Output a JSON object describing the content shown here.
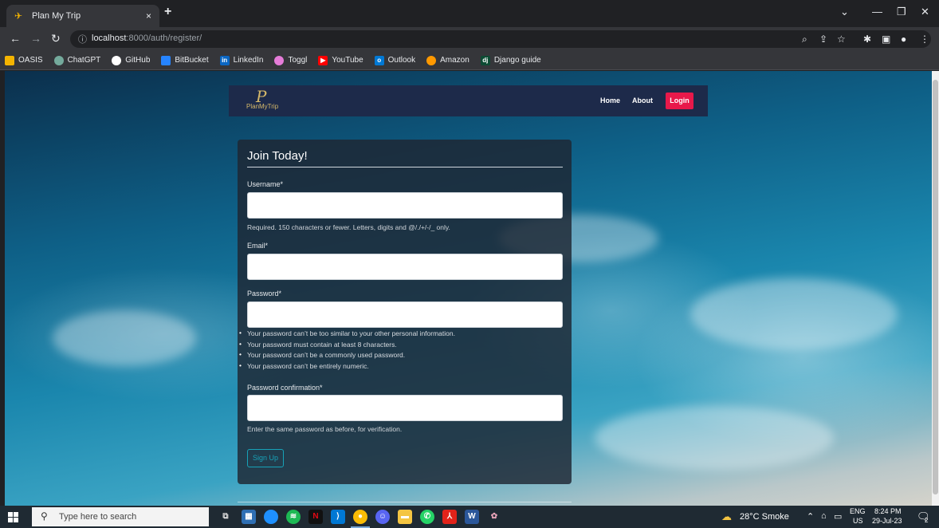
{
  "browser": {
    "tab_title": "Plan My Trip",
    "tab_close": "×",
    "new_tab": "+",
    "url_host": "localhost",
    "url_rest": ":8000/auth/register/",
    "bookmarks": [
      {
        "label": "OASIS",
        "color": "#f4b400"
      },
      {
        "label": "ChatGPT",
        "color": "#74aa9c"
      },
      {
        "label": "GitHub",
        "color": "#ffffff"
      },
      {
        "label": "BitBucket",
        "color": "#2684ff"
      },
      {
        "label": "LinkedIn",
        "color": "#0a66c2"
      },
      {
        "label": "Toggl",
        "color": "#e57cd8"
      },
      {
        "label": "YouTube",
        "color": "#ff0000"
      },
      {
        "label": "Outlook",
        "color": "#0078d4"
      },
      {
        "label": "Amazon",
        "color": "#ff9900"
      },
      {
        "label": "Django guide",
        "color": "#0c4b33"
      }
    ]
  },
  "site": {
    "brand_mark": "P",
    "brand_name": "PlanMyTrip",
    "nav": {
      "home": "Home",
      "about": "About",
      "login": "Login"
    },
    "accent": "#e8194a"
  },
  "form": {
    "title": "Join Today!",
    "username_label": "Username*",
    "username_help": "Required. 150 characters or fewer. Letters, digits and @/./+/-/_ only.",
    "email_label": "Email*",
    "password_label": "Password*",
    "password_rules": [
      "Your password can’t be too similar to your other personal information.",
      "Your password must contain at least 8 characters.",
      "Your password can’t be a commonly used password.",
      "Your password can’t be entirely numeric."
    ],
    "confirm_label": "Password confirmation*",
    "confirm_help": "Enter the same password as before, for verification.",
    "submit": "Sign Up"
  },
  "taskbar": {
    "search_placeholder": "Type here to search",
    "weather": "28°C Smoke",
    "lang_top": "ENG",
    "lang_bottom": "US",
    "time": "8:24 PM",
    "date": "29-Jul-23",
    "notifications": "2"
  }
}
